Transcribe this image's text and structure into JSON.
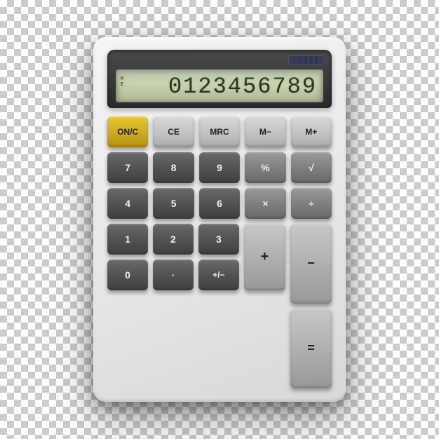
{
  "calculator": {
    "display": {
      "indicators": [
        "M",
        "E"
      ],
      "value": "0123456789"
    },
    "buttons": {
      "row1": [
        {
          "label": "ON/C",
          "type": "onc"
        },
        {
          "label": "CE",
          "type": "func"
        },
        {
          "label": "MRC",
          "type": "func"
        },
        {
          "label": "M−",
          "type": "func"
        },
        {
          "label": "M+",
          "type": "func"
        }
      ],
      "row2": [
        {
          "label": "7",
          "type": "dark"
        },
        {
          "label": "8",
          "type": "dark"
        },
        {
          "label": "9",
          "type": "dark"
        },
        {
          "label": "%",
          "type": "op"
        },
        {
          "label": "√",
          "type": "op"
        }
      ],
      "row3": [
        {
          "label": "4",
          "type": "dark"
        },
        {
          "label": "5",
          "type": "dark"
        },
        {
          "label": "6",
          "type": "dark"
        },
        {
          "label": "×",
          "type": "op"
        },
        {
          "label": "÷",
          "type": "op"
        }
      ],
      "row4_left": [
        {
          "label": "1",
          "type": "dark"
        },
        {
          "label": "2",
          "type": "dark"
        },
        {
          "label": "3",
          "type": "dark"
        }
      ],
      "row4_right_top": {
        "label": "+",
        "type": "light"
      },
      "row4_right_bottom": {
        "label": "−",
        "type": "light"
      },
      "row5_left": [
        {
          "label": "0",
          "type": "dark"
        },
        {
          "label": "·",
          "type": "dark"
        },
        {
          "label": "+/−",
          "type": "dark"
        }
      ],
      "row5_right": {
        "label": "=",
        "type": "light"
      }
    }
  }
}
